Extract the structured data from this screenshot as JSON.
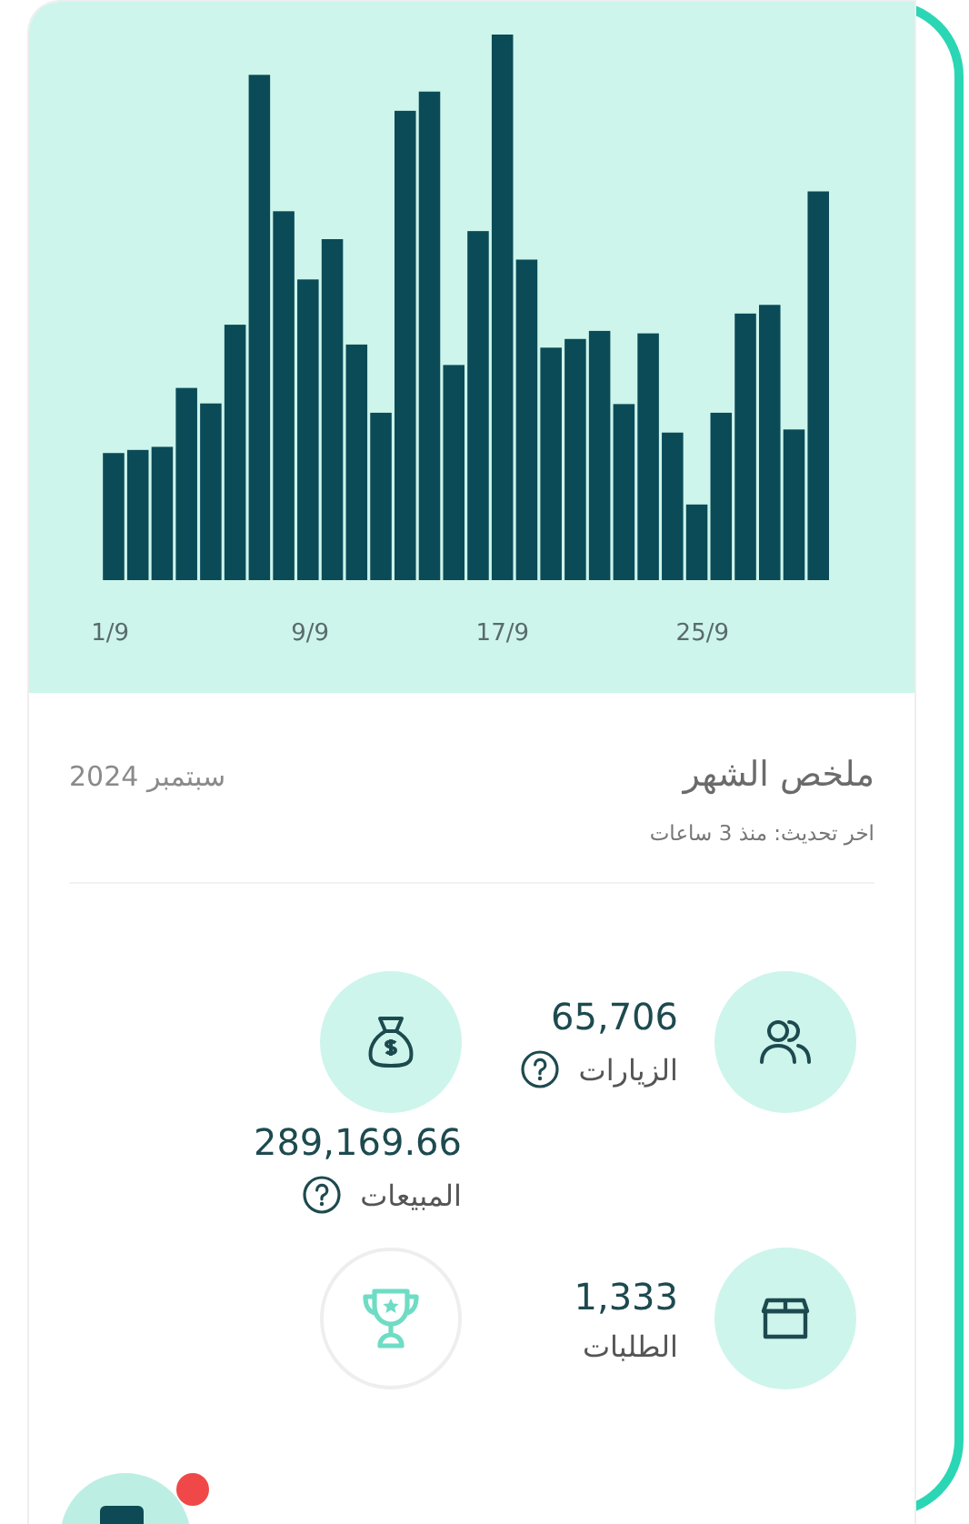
{
  "chart": {
    "x_labels": [
      "25/9",
      "17/9",
      "9/9",
      "1/9"
    ]
  },
  "summary": {
    "title": "ملخص الشهر",
    "period": "سبتمبر 2024",
    "updated": "اخر تحديث: منذ 3 ساعات"
  },
  "stats": [
    {
      "kind": "people",
      "value": "65,706",
      "label": "الزيارات",
      "help": true
    },
    {
      "kind": "sales",
      "value": "289,169.66",
      "label": "المبيعات",
      "help": true
    },
    {
      "kind": "orders",
      "value": "1,333",
      "label": "الطلبات",
      "help": false
    },
    {
      "kind": "achievement"
    }
  ],
  "floating_button": {
    "badge": true
  }
}
